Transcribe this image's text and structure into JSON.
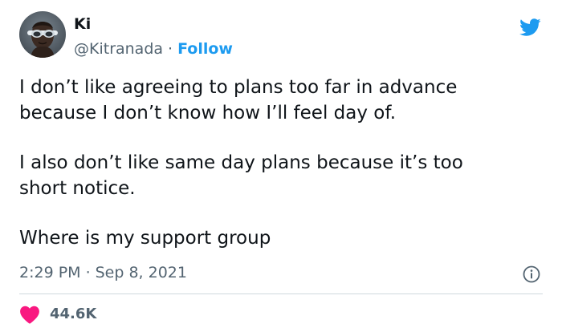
{
  "author": {
    "display_name": "Ki",
    "handle": "@Kitranada",
    "separator": "·",
    "follow_label": "Follow",
    "avatar_icon": "avatar-photo"
  },
  "tweet": {
    "paragraphs": [
      "I don’t like agreeing to plans too far in advance\nbecause I don’t know how I’ll feel day of.",
      "I also don’t like same day plans because it’s too\nshort notice.",
      "Where is my support group"
    ],
    "time": "2:29 PM",
    "separator": "·",
    "date": "Sep 8, 2021"
  },
  "stats": {
    "likes": "44.6K"
  },
  "icons": {
    "brand": "twitter-bird-icon",
    "info": "info-icon",
    "like": "heart-icon"
  },
  "colors": {
    "accent": "#1d9bf0",
    "text": "#0f1419",
    "secondary": "#536471",
    "heart": "#f91880",
    "divider": "#cfd9de"
  }
}
